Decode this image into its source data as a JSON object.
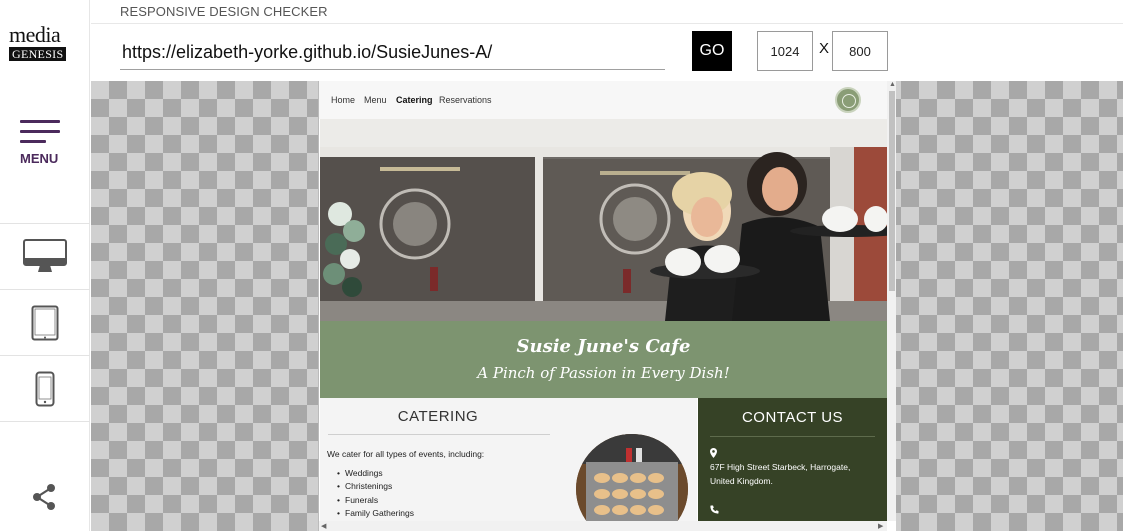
{
  "app": {
    "logo_top": "media",
    "logo_bottom": "GENESIS",
    "title": "RESPONSIVE DESIGN CHECKER",
    "menu_label": "MENU"
  },
  "toolbar": {
    "url": "https://elizabeth-yorke.github.io/SusieJunes-A/",
    "go_label": "GO",
    "width": "1024",
    "separator": "X",
    "height": "800"
  },
  "devices": [
    "desktop-icon",
    "tablet-icon",
    "phone-icon"
  ],
  "site": {
    "nav": [
      "Home",
      "Menu",
      "Catering",
      "Reservations"
    ],
    "active_nav": "Catering",
    "banner_title": "Susie June's Cafe",
    "banner_subtitle": "A Pinch of Passion in Every Dish!",
    "catering_heading": "CATERING",
    "catering_intro": "We cater for all types of events, including:",
    "events": [
      "Weddings",
      "Christenings",
      "Funerals",
      "Family Gatherings"
    ],
    "contact_heading": "CONTACT US",
    "address_line1": "67F High Street Starbeck, Harrogate,",
    "address_line2": "United Kingdom."
  },
  "colors": {
    "brand_purple": "#4b2a5c",
    "banner_green": "#7d9470",
    "contact_green": "#364226"
  }
}
